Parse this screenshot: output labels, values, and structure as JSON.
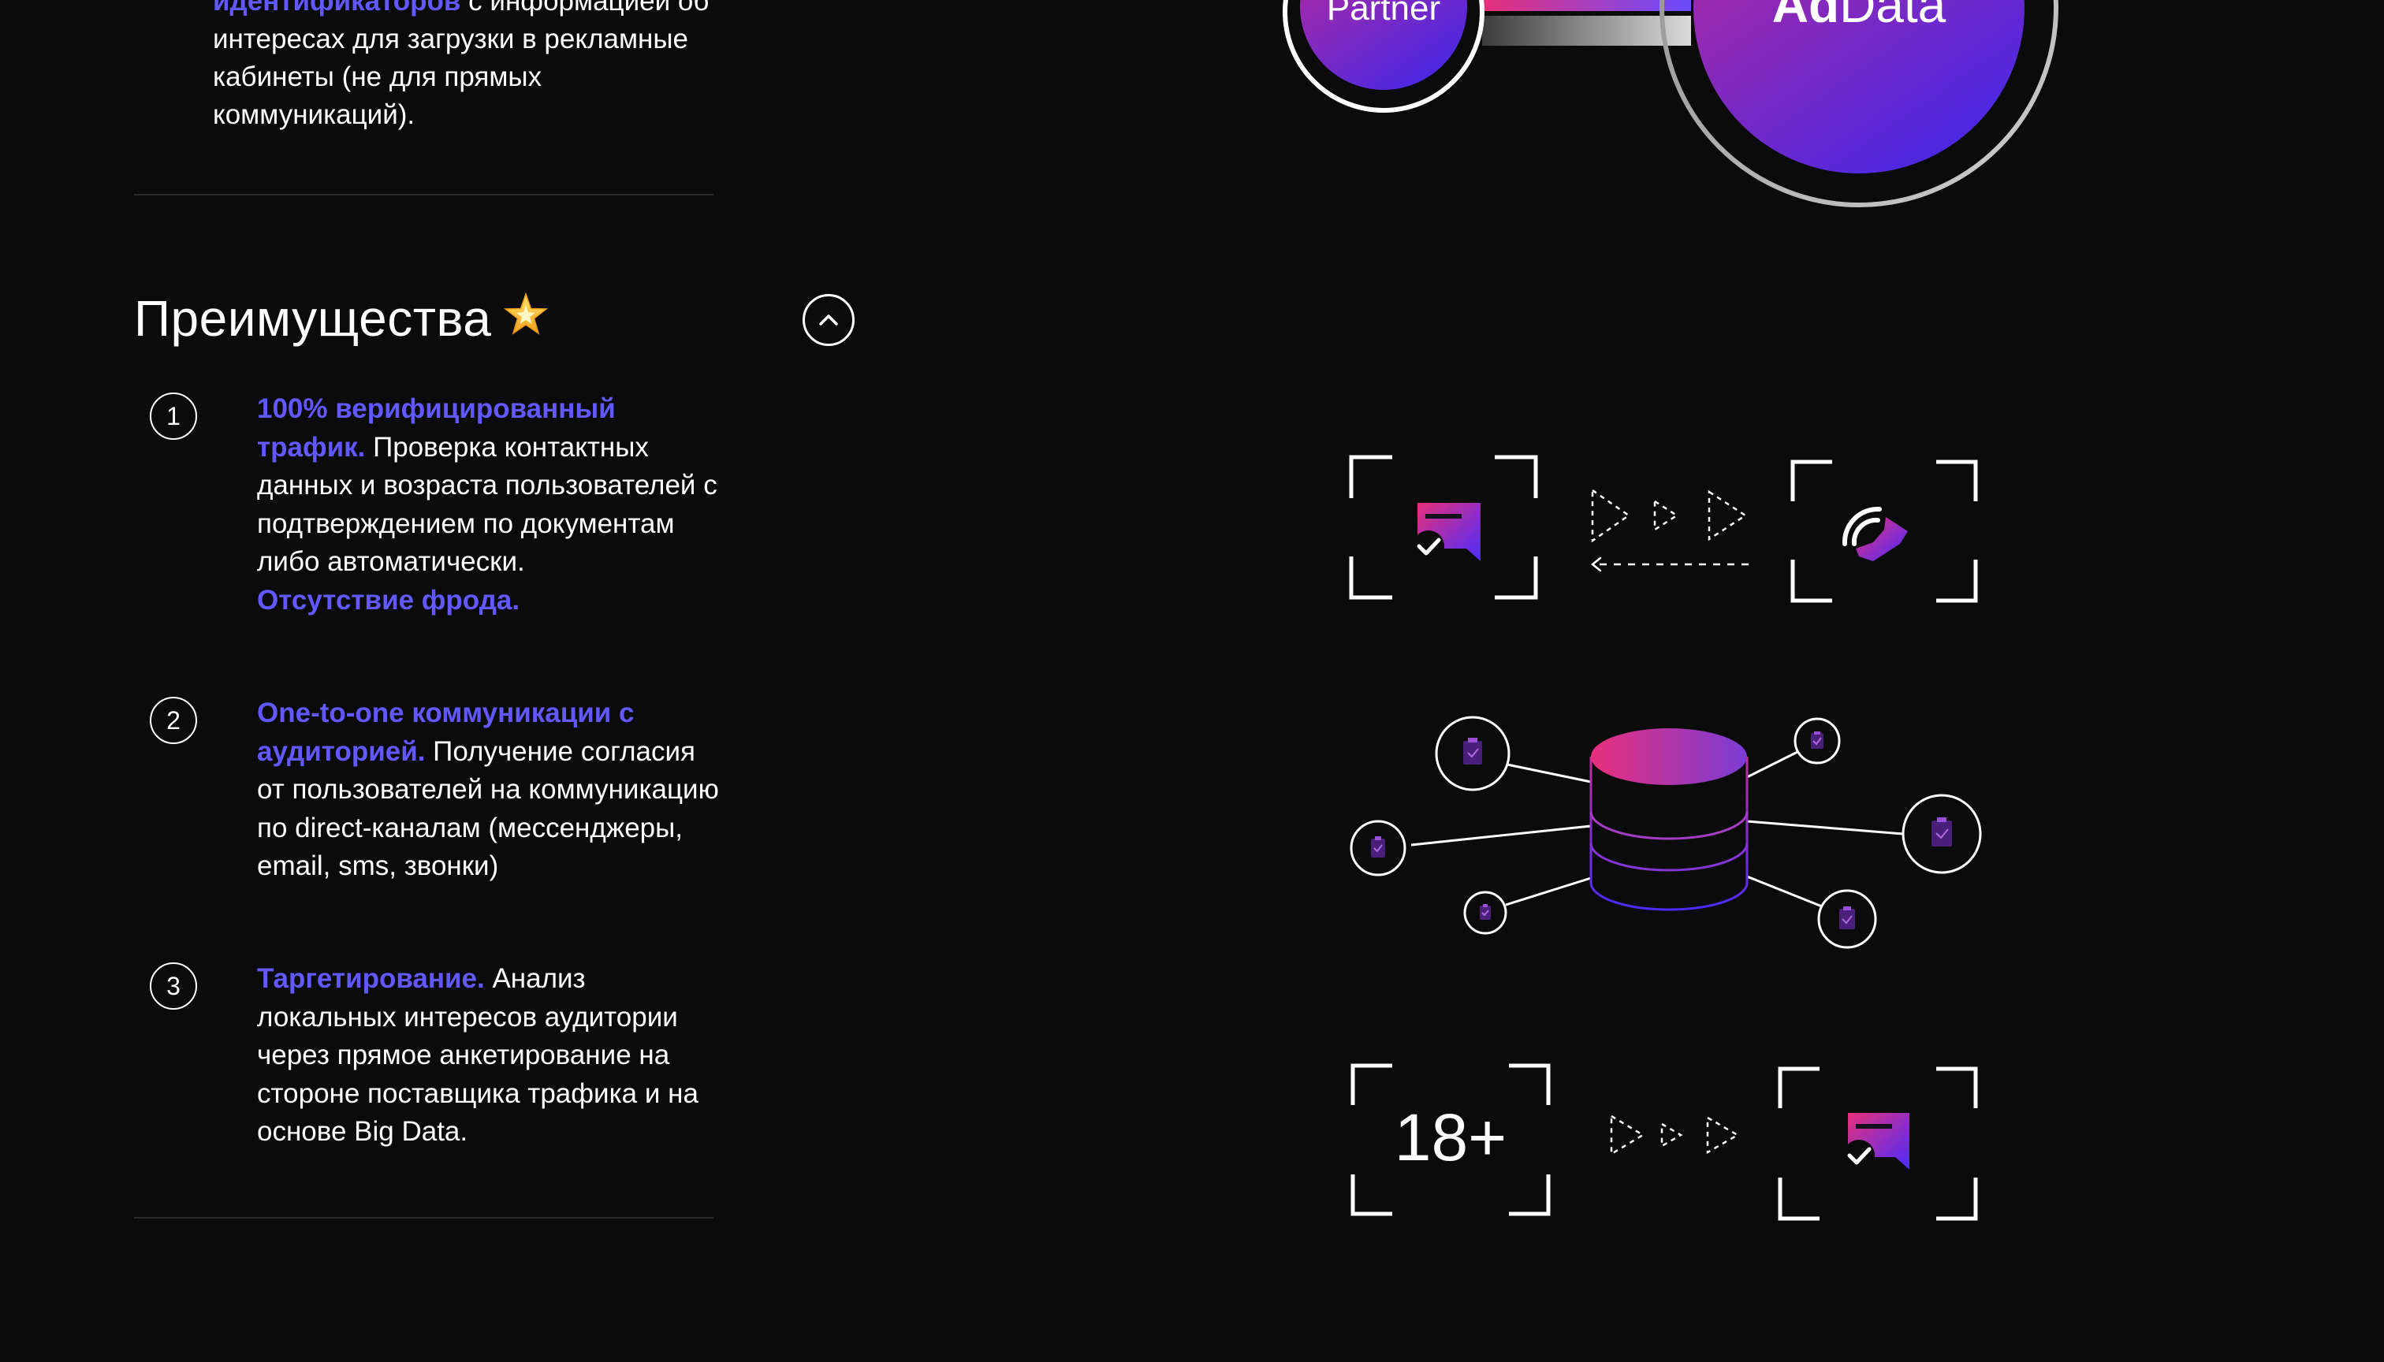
{
  "intro": {
    "highlight": "идентификаторов",
    "rest": " с информацией об интересах для загрузки в рекламные кабинеты (не для прямых коммуникаций)."
  },
  "section": {
    "title": "Преимущества",
    "toggle_icon": "chevron-up-icon",
    "star_icon": "star-emoji-icon"
  },
  "advantages": [
    {
      "number": "1",
      "highlight": "100% верифицированный трафик.",
      "text": " Проверка контактных данных и возраста пользователей с подтверждением по документам либо автоматически.",
      "highlight2": "Отсутствие фрода."
    },
    {
      "number": "2",
      "highlight": "One-to-one коммуникации с аудиторией.",
      "text": " Получение согласия от пользователей на коммуникацию по direct-каналам (мессенджеры, email, sms, звонки)"
    },
    {
      "number": "3",
      "highlight": "Таргетирование.",
      "text": " Анализ локальных интересов аудитории через прямое анкетирование на стороне поставщика трафика и на основе Big Data."
    }
  ],
  "illustration": {
    "partner_label": "Partner",
    "brand_bold": "Ad",
    "brand_regular": "Data",
    "age_label": "18+"
  },
  "colors": {
    "accent": "#6158ff",
    "gradient_start": "#e8307a",
    "gradient_end": "#4a2bff",
    "background": "#0b0b0c"
  }
}
